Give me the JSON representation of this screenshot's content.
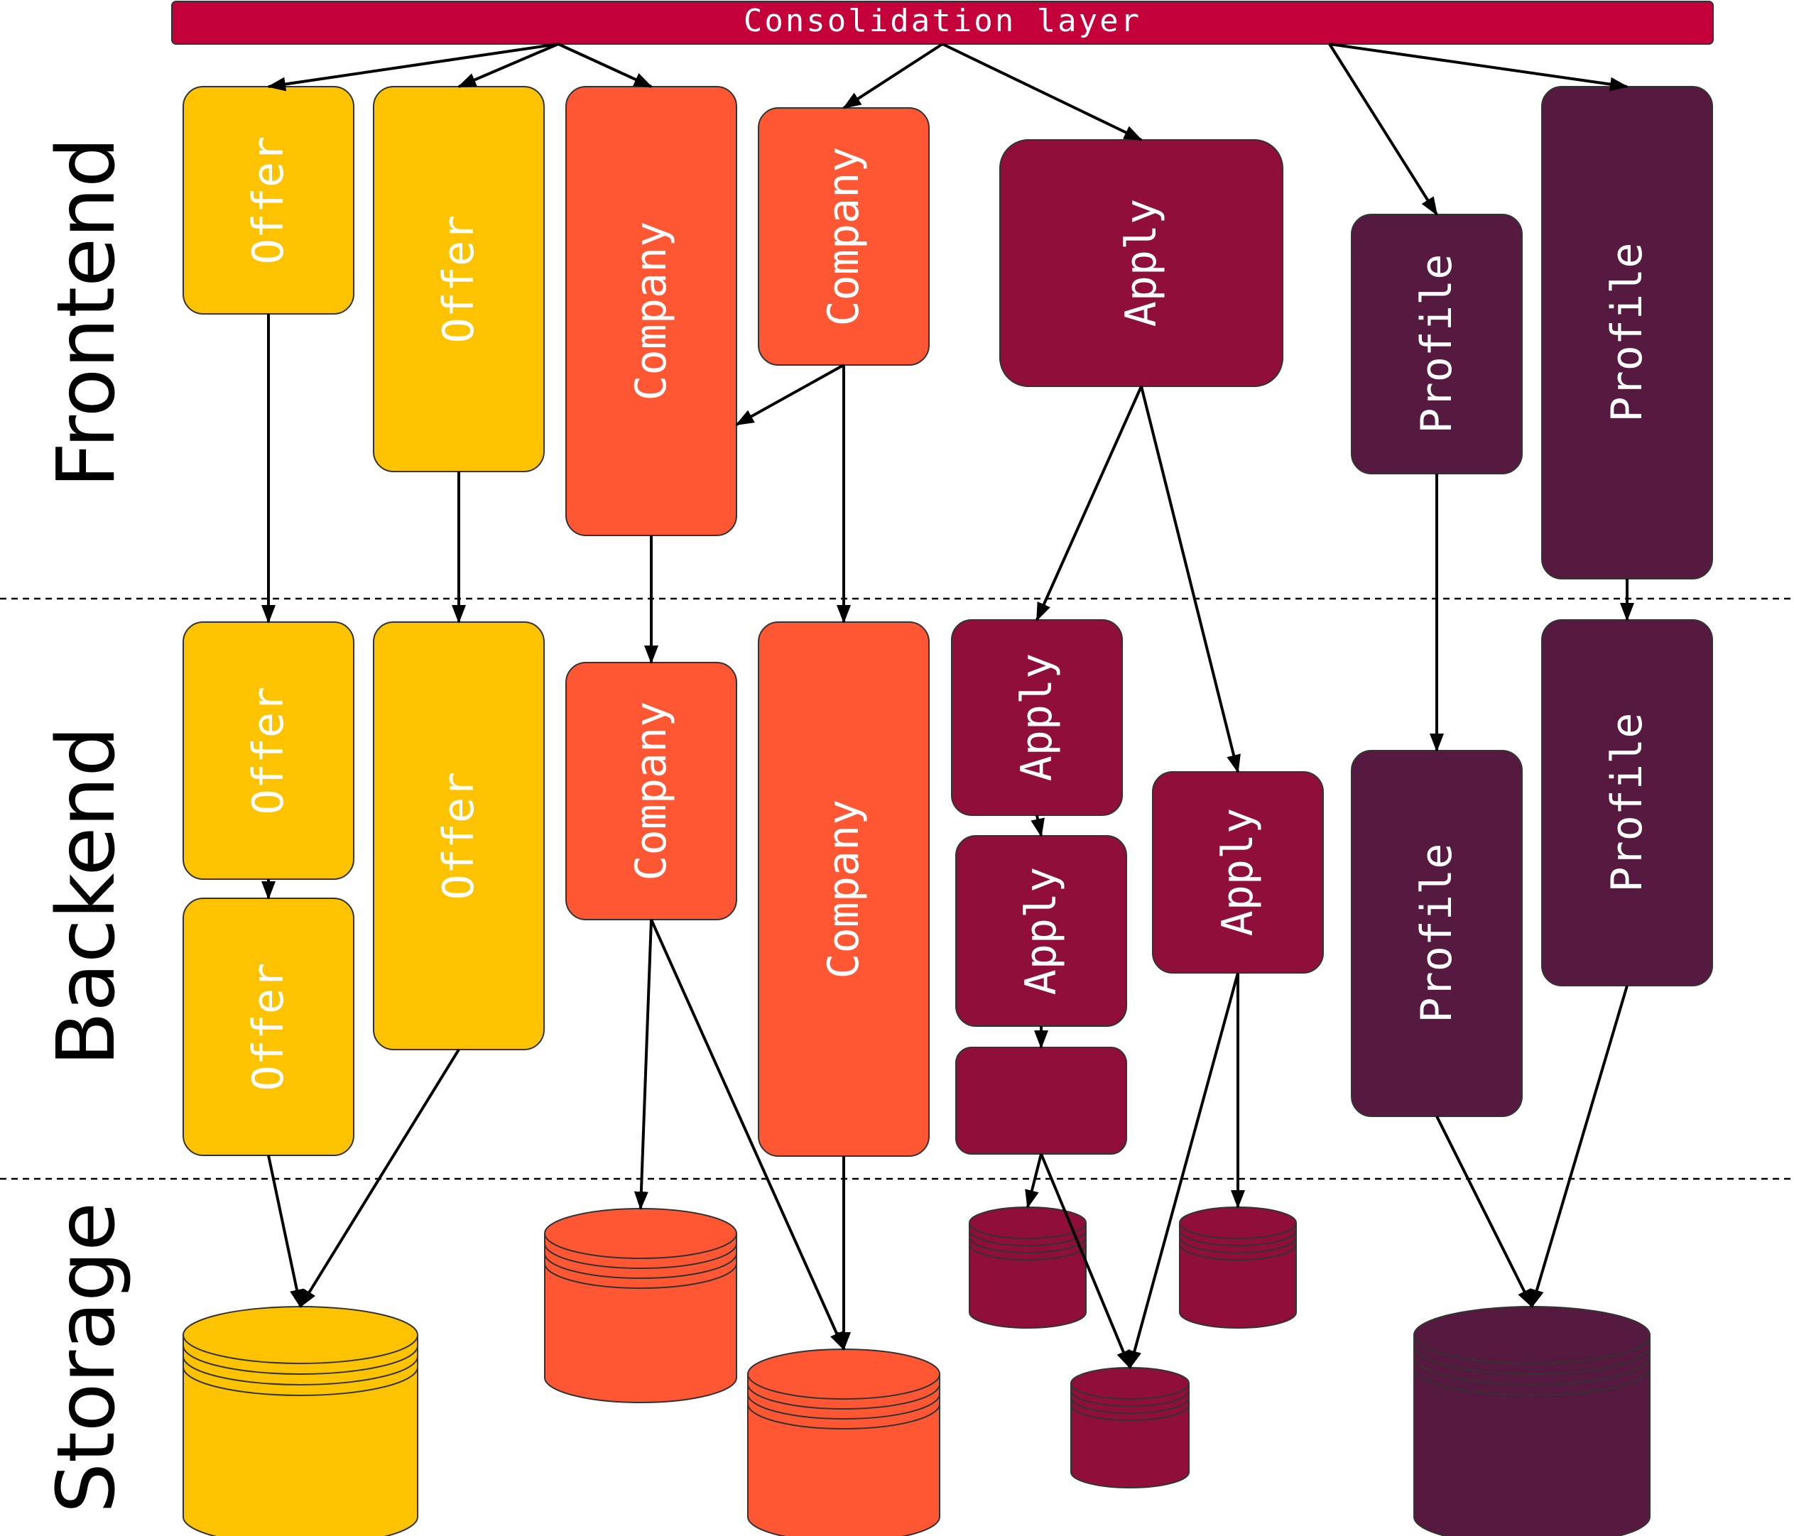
{
  "consolidation": {
    "label": "Consolidation layer"
  },
  "layers": {
    "frontend": "Frontend",
    "backend": "Backend",
    "storage": "Storage"
  },
  "labels": {
    "offer": "Offer",
    "company": "Company",
    "apply": "Apply",
    "profile": "Profile"
  },
  "colors": {
    "consolidation": "#c4003a",
    "offer": "#fdc300",
    "company": "#ff5733",
    "apply": "#8f0e3a",
    "profile": "#561940",
    "outline": "#333333",
    "arrow": "#000000",
    "label_text": "#ffffff"
  }
}
